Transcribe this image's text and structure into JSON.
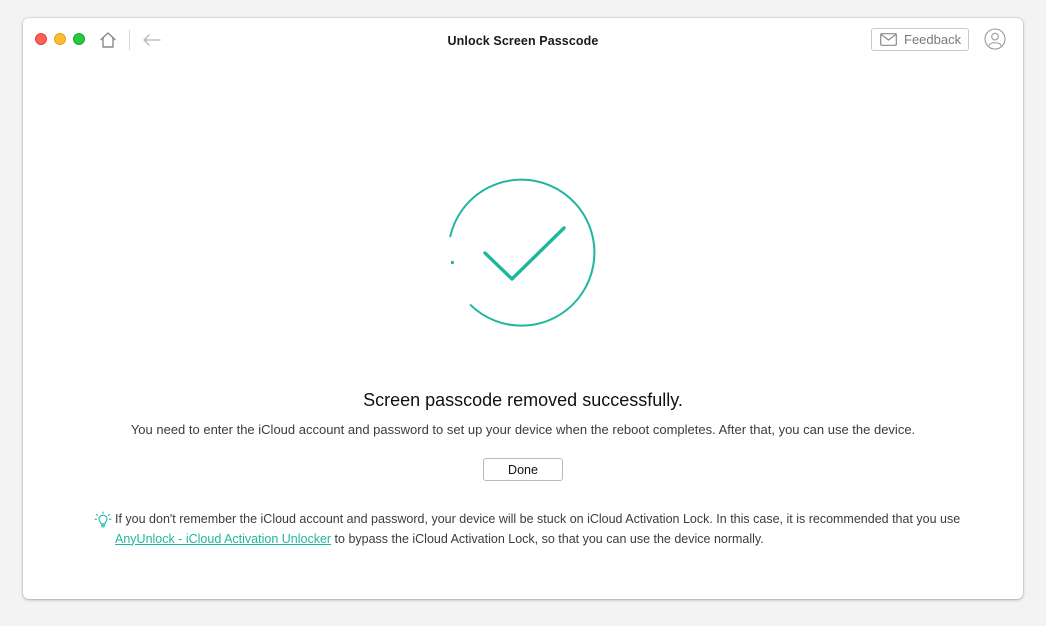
{
  "window": {
    "title": "Unlock Screen Passcode"
  },
  "toolbar": {
    "feedback_label": "Feedback"
  },
  "main": {
    "heading": "Screen passcode removed successfully.",
    "subtext": "You need to enter the iCloud account and password to set up your device when the reboot completes. After that, you can use the device.",
    "done_label": "Done"
  },
  "tip": {
    "text_before": "If you don't remember the iCloud account and password, your device will be stuck on iCloud Activation Lock. In this case, it is recommended that you use ",
    "link_text": "AnyUnlock - iCloud Activation Unlocker",
    "text_after": " to bypass the iCloud Activation Lock, so that you can use the device normally."
  },
  "icons": {
    "home": "home-icon",
    "back": "back-arrow-icon",
    "mail": "mail-icon",
    "account": "account-icon",
    "success": "checkmark-circle-icon",
    "tip": "lightbulb-icon"
  },
  "colors": {
    "accent": "#1fb6a0",
    "close": "#fe5f57",
    "minimize": "#febc2e",
    "zoom": "#28c840"
  }
}
